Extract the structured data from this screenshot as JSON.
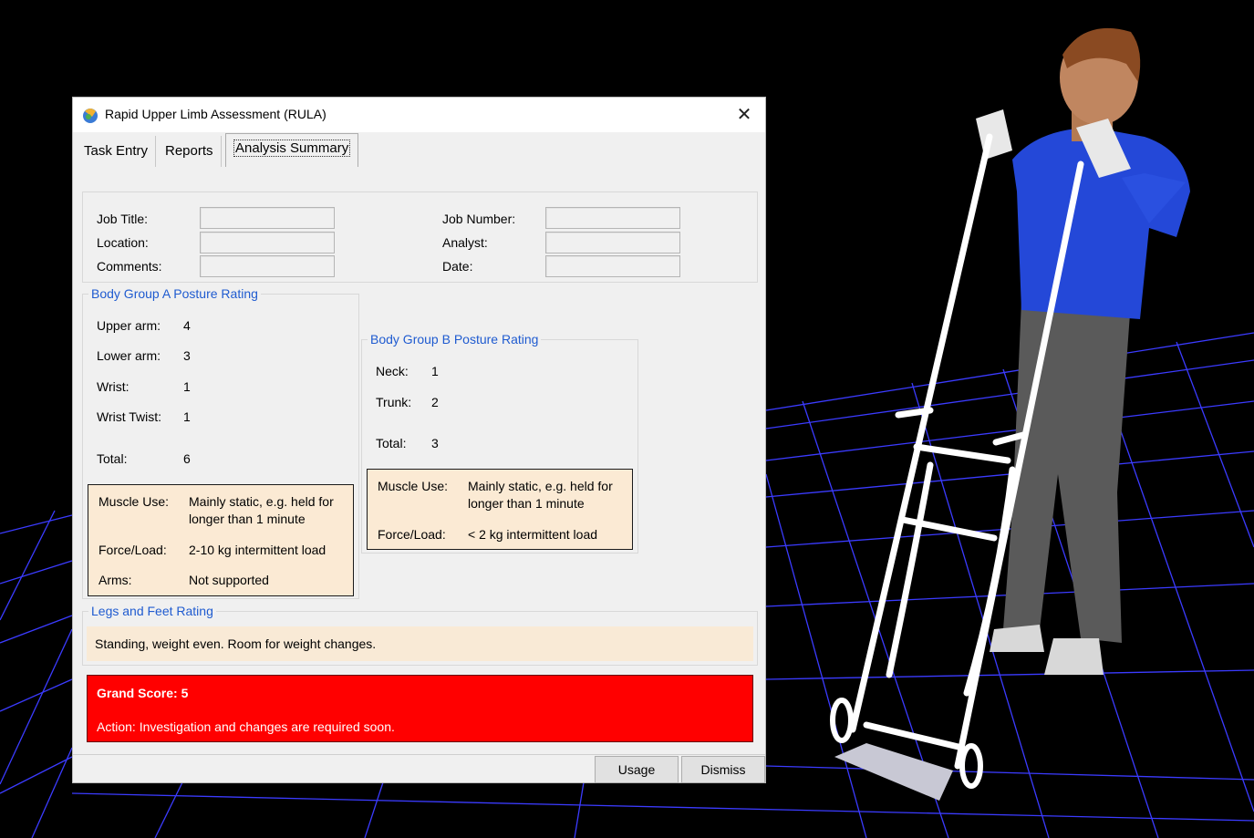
{
  "window": {
    "title": "Rapid Upper Limb Assessment (RULA)"
  },
  "tabs": [
    {
      "label": "Task Entry",
      "active": false
    },
    {
      "label": "Reports",
      "active": false
    },
    {
      "label": "Analysis Summary",
      "active": true
    }
  ],
  "job_info": {
    "job_title_label": "Job Title:",
    "job_title_value": "",
    "location_label": "Location:",
    "location_value": "",
    "comments_label": "Comments:",
    "comments_value": "",
    "job_number_label": "Job Number:",
    "job_number_value": "",
    "analyst_label": "Analyst:",
    "analyst_value": "",
    "date_label": "Date:",
    "date_value": ""
  },
  "group_a": {
    "legend": "Body Group A Posture Rating",
    "upper_arm_label": "Upper arm:",
    "upper_arm_value": "4",
    "lower_arm_label": "Lower arm:",
    "lower_arm_value": "3",
    "wrist_label": "Wrist:",
    "wrist_value": "1",
    "wrist_twist_label": "Wrist Twist:",
    "wrist_twist_value": "1",
    "total_label": "Total:",
    "total_value": "6",
    "muscle_use_label": "Muscle Use:",
    "muscle_use_line1": "Mainly static, e.g. held for",
    "muscle_use_line2": "longer than 1 minute",
    "force_label": "Force/Load:",
    "force_value": "2-10 kg intermittent load",
    "arms_label": "Arms:",
    "arms_value": "Not supported"
  },
  "group_b": {
    "legend": "Body Group B Posture Rating",
    "neck_label": "Neck:",
    "neck_value": "1",
    "trunk_label": "Trunk:",
    "trunk_value": "2",
    "total_label": "Total:",
    "total_value": "3",
    "muscle_use_label": "Muscle Use:",
    "muscle_use_line1": "Mainly static, e.g. held for",
    "muscle_use_line2": "longer than 1 minute",
    "force_label": "Force/Load:",
    "force_value": "< 2 kg intermittent load"
  },
  "legs": {
    "legend": "Legs and Feet Rating",
    "text": "Standing, weight even.  Room for weight changes."
  },
  "grand": {
    "score_text": "Grand Score:  5",
    "action_text": "Action:  Investigation and changes are required soon."
  },
  "buttons": {
    "usage": "Usage",
    "dismiss": "Dismiss"
  },
  "colors": {
    "grand_bg": "#ff0000",
    "legend": "#1f5bd0",
    "info_bg": "#fbead4",
    "grid": "#3a3aff"
  }
}
